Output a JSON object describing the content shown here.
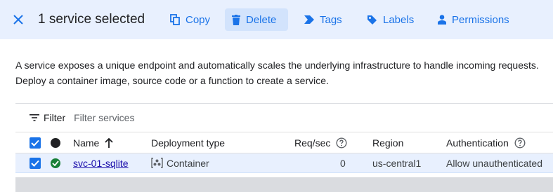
{
  "toolbar": {
    "selection_title": "1 service selected",
    "actions": {
      "copy": "Copy",
      "delete": "Delete",
      "tags": "Tags",
      "labels": "Labels",
      "permissions": "Permissions"
    }
  },
  "description": {
    "line1": "A service exposes a unique endpoint and automatically scales the underlying infrastructure to handle incoming requests.",
    "line2": "Deploy a container image, source code or a function to create a service."
  },
  "filter": {
    "label": "Filter",
    "placeholder": "Filter services"
  },
  "table": {
    "headers": {
      "name": "Name",
      "deployment_type": "Deployment type",
      "req_sec": "Req/sec",
      "region": "Region",
      "authentication": "Authentication"
    },
    "rows": [
      {
        "name": "svc-01-sqlite",
        "deployment_type": "Container",
        "req_sec": "0",
        "region": "us-central1",
        "authentication": "Allow unauthenticated"
      }
    ]
  },
  "colors": {
    "accent": "#1a73e8",
    "selection_bg": "#e8f0fe",
    "status_ok": "#188038"
  }
}
